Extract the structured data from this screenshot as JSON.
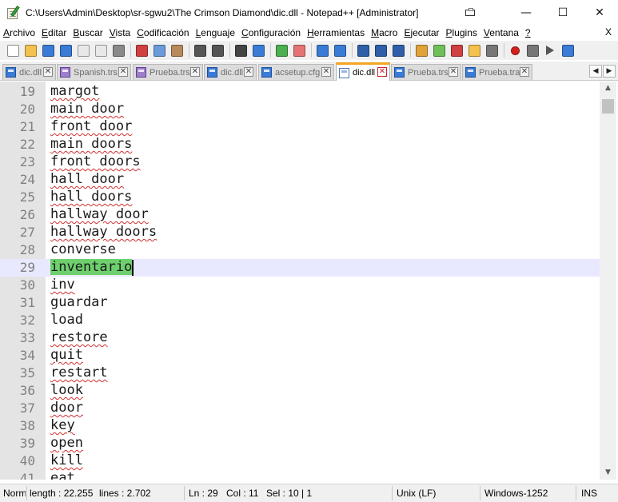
{
  "window": {
    "title": "C:\\Users\\Admin\\Desktop\\sr-sgwu2\\The Crimson Diamond\\dic.dll - Notepad++ [Administrator]",
    "minimize_glyph": "—",
    "maximize_glyph": "☐",
    "close_glyph": "✕"
  },
  "menu": {
    "items": [
      {
        "u": "A",
        "rest": "rchivo"
      },
      {
        "u": "E",
        "rest": "ditar"
      },
      {
        "u": "B",
        "rest": "uscar"
      },
      {
        "u": "V",
        "rest": "ista"
      },
      {
        "u": "C",
        "rest": "odificación"
      },
      {
        "u": "L",
        "rest": "enguaje"
      },
      {
        "u": "C",
        "rest": "onfiguración"
      },
      {
        "u": "H",
        "rest": "erramientas"
      },
      {
        "u": "M",
        "rest": "acro"
      },
      {
        "u": "E",
        "rest": "jecutar"
      },
      {
        "u": "P",
        "rest": "lugins"
      },
      {
        "u": "V",
        "rest": "entana"
      },
      {
        "u": "?",
        "rest": ""
      }
    ],
    "close_label": "X"
  },
  "toolbar": {
    "icons": [
      "new-file-icon",
      "open-file-icon",
      "save-icon",
      "save-all-icon",
      "close-icon",
      "close-all-icon",
      "print-icon",
      "sep",
      "cut-icon",
      "copy-icon",
      "paste-icon",
      "sep",
      "undo-icon",
      "redo-icon",
      "sep",
      "find-icon",
      "replace-icon",
      "sep",
      "zoom-in-icon",
      "zoom-out-icon",
      "sep",
      "sync-vertical-icon",
      "sync-horizontal-icon",
      "sep",
      "word-wrap-icon",
      "show-all-chars-icon",
      "indent-guide-icon",
      "sep",
      "define-language-icon",
      "map-icon",
      "function-list-icon",
      "folder-icon",
      "monitor-icon",
      "sep",
      "record-macro-icon",
      "stop-record-icon",
      "play-macro-icon",
      "run-macro-icon"
    ]
  },
  "tabs": [
    {
      "label": "dic.dll",
      "color": "blue",
      "active": false
    },
    {
      "label": "Spanish.trs",
      "color": "purple",
      "active": false
    },
    {
      "label": "Prueba.trs",
      "color": "purple",
      "active": false
    },
    {
      "label": "dic.dll",
      "color": "blue",
      "active": false
    },
    {
      "label": "acsetup.cfg",
      "color": "blue",
      "active": false
    },
    {
      "label": "dic.dll",
      "color": "white",
      "active": true
    },
    {
      "label": "Prueba.trs",
      "color": "blue",
      "active": false
    },
    {
      "label": "Prueba.tra",
      "color": "blue",
      "active": false
    }
  ],
  "tab_scroll": {
    "left": "◀",
    "right": "▶"
  },
  "editor": {
    "lines": [
      {
        "n": "19",
        "text": "margot",
        "spell": true
      },
      {
        "n": "20",
        "text": "main door",
        "spell": true
      },
      {
        "n": "21",
        "text": "front door",
        "spell": true
      },
      {
        "n": "22",
        "text": "main doors",
        "spell": true
      },
      {
        "n": "23",
        "text": "front doors",
        "spell": true
      },
      {
        "n": "24",
        "text": "hall door",
        "spell": true
      },
      {
        "n": "25",
        "text": "hall doors",
        "spell": true
      },
      {
        "n": "26",
        "text": "hallway door",
        "spell": true
      },
      {
        "n": "27",
        "text": "hallway doors",
        "spell": true
      },
      {
        "n": "28",
        "text": "converse",
        "spell": false
      },
      {
        "n": "29",
        "text": "inventario",
        "spell": false,
        "selected": true,
        "current": true
      },
      {
        "n": "30",
        "text": "inv",
        "spell": true
      },
      {
        "n": "31",
        "text": "guardar",
        "spell": false
      },
      {
        "n": "32",
        "text": "load",
        "spell": false
      },
      {
        "n": "33",
        "text": "restore",
        "spell": true
      },
      {
        "n": "34",
        "text": "quit",
        "spell": true
      },
      {
        "n": "35",
        "text": "restart",
        "spell": true
      },
      {
        "n": "36",
        "text": "look",
        "spell": true
      },
      {
        "n": "37",
        "text": "door",
        "spell": true
      },
      {
        "n": "38",
        "text": "key",
        "spell": true
      },
      {
        "n": "39",
        "text": "open",
        "spell": true
      },
      {
        "n": "40",
        "text": "kill",
        "spell": true
      },
      {
        "n": "41",
        "text": "eat",
        "spell": true
      }
    ]
  },
  "scrollbar": {
    "up": "▲",
    "down": "▼"
  },
  "status": {
    "mode": "Normal text file",
    "length": "length : 22.255",
    "lines": "lines : 2.702",
    "ln": "Ln : 29",
    "col": "Col : 11",
    "sel": "Sel : 10 | 1",
    "eol": "Unix (LF)",
    "encoding": "Windows-1252",
    "ins": "INS"
  }
}
